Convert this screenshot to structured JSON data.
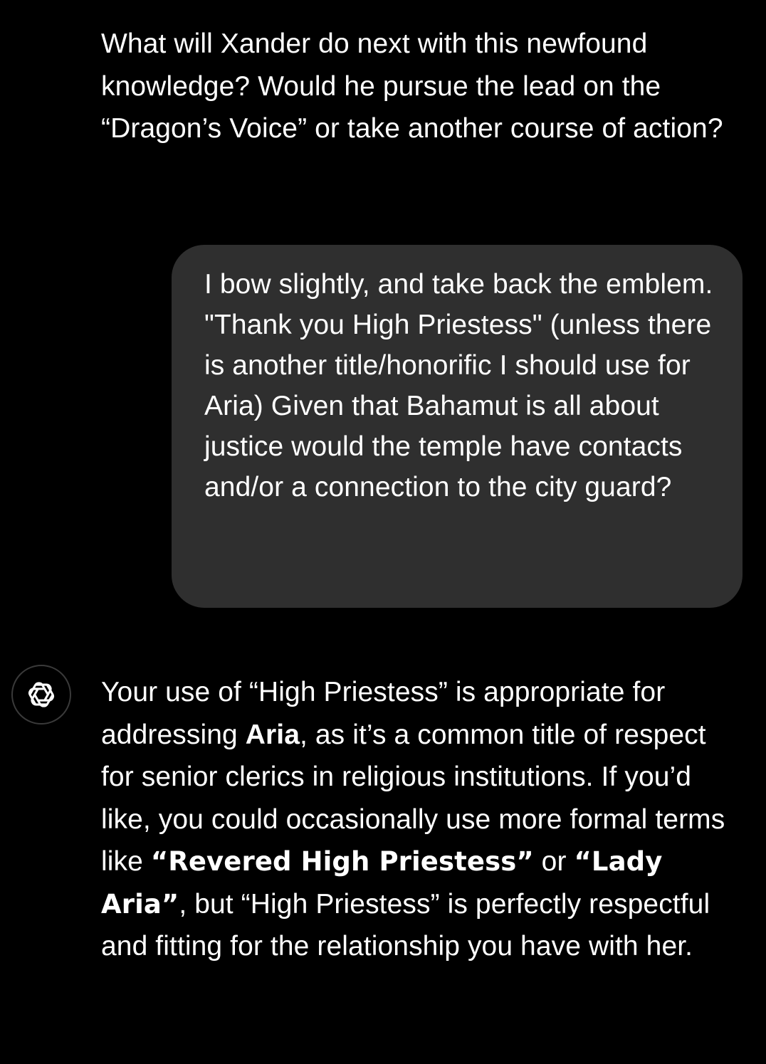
{
  "conversation": {
    "assistant_prev": {
      "text": "What will Xander do next with this newfound knowledge? Would he pursue the lead on the “Dragon’s Voice” or take another course of action?"
    },
    "user_message": {
      "text": "I bow slightly, and take back the emblem. \"Thank you High Priestess\" (unless there is another title/honorific I should use for Aria) Given that Bahamut is all about justice would the temple have contacts and/or a connection to the city guard?"
    },
    "assistant_reply": {
      "avatar_icon": "openai-logo-icon",
      "segments": {
        "s1": "Your use of “High Priestess” is appropriate for addressing ",
        "s2": "Aria",
        "s3": ", as it’s a common title of respect for senior clerics in religious institutions. If you’d like, you could occasionally use more formal terms like ",
        "s4": "“Revered High Priestess”",
        "s5": " or ",
        "s6": "“Lady Aria”",
        "s7": ", but “High Priestess” is perfectly respectful and fitting for the relationship you have with her."
      }
    }
  },
  "colors": {
    "background": "#000000",
    "bubble": "#2f2f2f",
    "text": "#ffffff"
  }
}
